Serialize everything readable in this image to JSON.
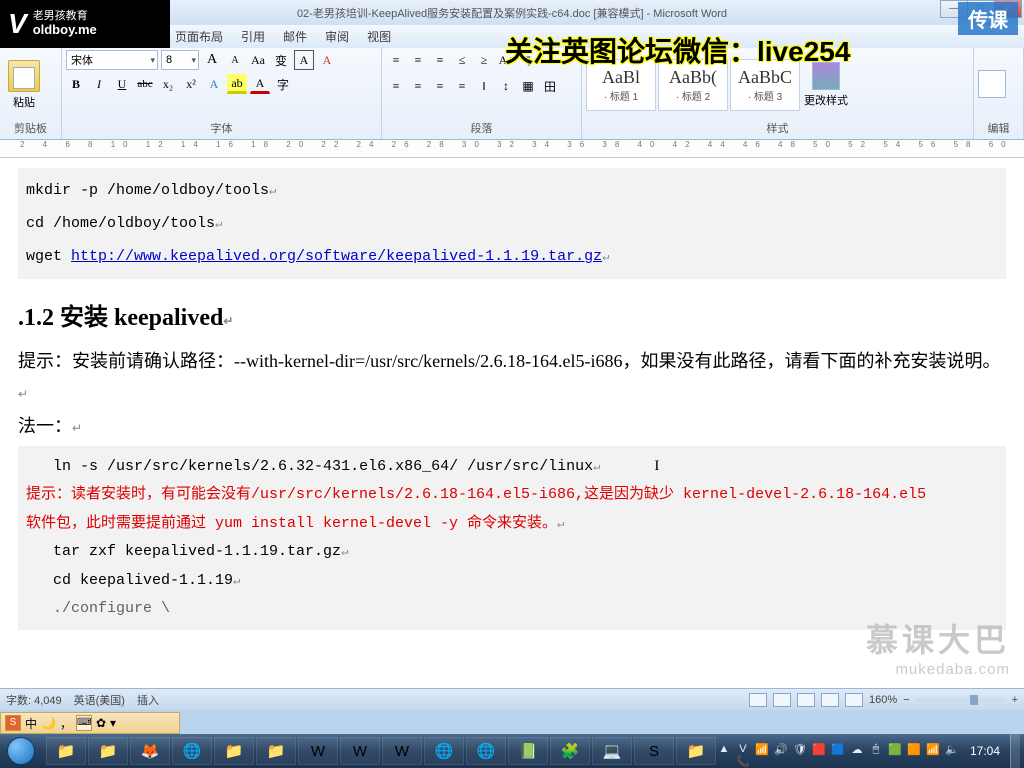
{
  "window": {
    "title": "02-老男孩培训-KeepAlived服务安装配置及案例实践-c64.doc [兼容模式] - Microsoft Word",
    "min": "—",
    "max": "□",
    "close": "×"
  },
  "logo": {
    "brand": "老男孩教育",
    "domain": "oldboy.me"
  },
  "overlay": {
    "wechat": "关注英图论坛微信：live254",
    "chuanke": "传课"
  },
  "menu": {
    "layout": "页面布局",
    "ref": "引用",
    "mail": "邮件",
    "review": "审阅",
    "view": "视图"
  },
  "ribbon": {
    "clipboard": {
      "paste": "粘贴",
      "label": "剪贴板"
    },
    "font": {
      "name": "宋体",
      "size": "8",
      "label": "字体",
      "bold": "B",
      "italic": "I",
      "underline": "U",
      "strike": "abc",
      "sub": "x₂",
      "sup": "x²",
      "grow": "A",
      "shrink": "A",
      "case": "Aa",
      "phonetic": "变",
      "charborder": "A",
      "clear": "A",
      "highlight": "ab",
      "fontcolor": "A",
      "circled": "字",
      "bigA": "A"
    },
    "paragraph": {
      "label": "段落",
      "bullets": "≡",
      "numbers": "≡",
      "multilist": "≡",
      "indentdec": "≤",
      "indentinc": "≥",
      "sort": "A↓",
      "marks": "¶",
      "alignl": "≡",
      "alignc": "≡",
      "alignr": "≡",
      "alignj": "≡",
      "lines": "‖",
      "spacing": "↕",
      "shading": "▦",
      "border": "田"
    },
    "styles": {
      "label": "样式",
      "s1prev": "AaBl",
      "s1name": "· 标题 1",
      "s2prev": "AaBb(",
      "s2name": "· 标题 2",
      "s3prev": "AaBbC",
      "s3name": "· 标题 3",
      "change": "更改样式"
    },
    "editing": {
      "label": "编辑"
    }
  },
  "doc": {
    "code1_l1": "mkdir -p /home/oldboy/tools",
    "code1_l2": "cd /home/oldboy/tools",
    "code1_l3a": "wget ",
    "code1_l3link": "http://www.keepalived.org/software/keepalived-1.1.19.tar.gz",
    "heading": ".1.2 安装 keepalived",
    "tip1": "提示：安装前请确认路径：--with-kernel-dir=/usr/src/kernels/2.6.18-164.el5-i686，如果没有此路径，请看下面的补充安装说明。",
    "method1": "法一：",
    "code2_l1": "ln -s /usr/src/kernels/2.6.32-431.el6.x86_64/ /usr/src/linux",
    "code2_red1": "   提示：读者安装时，有可能会没有/usr/src/kernels/2.6.18-164.el5-i686,这是因为缺少 kernel-devel-2.6.18-164.el5",
    "code2_red2": "软件包，此时需要提前通过 yum install kernel-devel -y 命令来安装。",
    "code2_l2": "tar zxf keepalived-1.1.19.tar.gz",
    "code2_l3": "cd keepalived-1.1.19",
    "code2_l4": "./configure \\",
    "pil": "↵"
  },
  "mukedaba": {
    "cn": "慕课大巴",
    "en": "mukedaba.com"
  },
  "status": {
    "words": "字数: 4,049",
    "lang": "英语(美国)",
    "mode": "插入",
    "zoom": "160%",
    "minus": "−",
    "plus": "+"
  },
  "ime": {
    "s": "S",
    "zh": "中",
    "moon": "🌙",
    "comma": "，",
    "kb": "⌨",
    "gear": "✿",
    "tri": "▾"
  },
  "taskbar": {
    "icons": [
      "📁",
      "📁",
      "🦊",
      "🌐",
      "📁",
      "📁",
      "W",
      "W",
      "W",
      "🌐",
      "🌐",
      "📗",
      "🧩",
      "💻",
      "S",
      "📁"
    ],
    "tray": [
      "▲",
      "V📞",
      "📶",
      "🔊",
      "🛡",
      "🟥",
      "🟦",
      "☁",
      "🖱",
      "🟩",
      "🟧",
      "📶",
      "🔈"
    ],
    "clock": "17:04"
  }
}
